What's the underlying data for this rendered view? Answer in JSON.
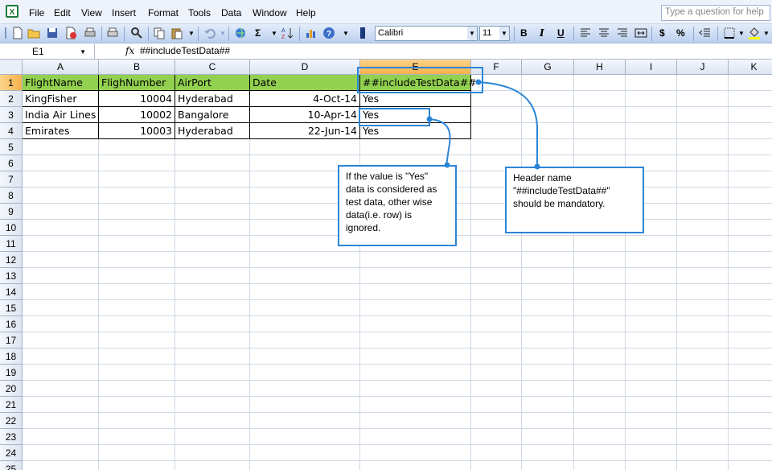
{
  "menu": [
    "File",
    "Edit",
    "View",
    "Insert",
    "Format",
    "Tools",
    "Data",
    "Window",
    "Help"
  ],
  "menu_underline": [
    "F",
    "E",
    "V",
    "I",
    "o",
    "T",
    "D",
    "W",
    "H"
  ],
  "ask_placeholder": "Type a question for help",
  "toolbar": {
    "font": "Calibri",
    "size": "11",
    "bold": "B",
    "italic": "I",
    "underline": "U",
    "currency": "$",
    "percent": "%",
    "sigma": "Σ"
  },
  "formula_bar": {
    "name_box": "E1",
    "fx": "fx",
    "formula": "##includeTestData##"
  },
  "columns": [
    "A",
    "B",
    "C",
    "D",
    "E",
    "F",
    "G",
    "H",
    "I",
    "J",
    "K"
  ],
  "selected_column": "E",
  "selected_row": "1",
  "rows": [
    "1",
    "2",
    "3",
    "4",
    "5",
    "6",
    "7",
    "8",
    "9",
    "10",
    "11",
    "12",
    "13",
    "14",
    "15",
    "16",
    "17",
    "18",
    "19",
    "20",
    "21",
    "22",
    "23",
    "24",
    "25"
  ],
  "sheet": {
    "header": [
      "FlightName",
      "FlighNumber",
      "AirPort",
      "Date",
      "##includeTestData##"
    ],
    "data": [
      [
        "KingFisher",
        "10004",
        "Hyderabad",
        "4-Oct-14",
        "Yes"
      ],
      [
        "India Air Lines",
        "10002",
        "Bangalore",
        "10-Apr-14",
        "Yes"
      ],
      [
        "Emirates",
        "10003",
        "Hyderabad",
        "22-Jun-14",
        "Yes"
      ]
    ]
  },
  "callouts": {
    "value_note": "If the value is \"Yes\" data is considered as test data, other wise data(i.e. row) is ignored.",
    "header_note": "Header name \"##includeTestData##\" should be mandatory."
  },
  "colors": {
    "header_fill": "#92d050",
    "callout_border": "#2b85d6",
    "selected_header": "#f6b24b"
  }
}
